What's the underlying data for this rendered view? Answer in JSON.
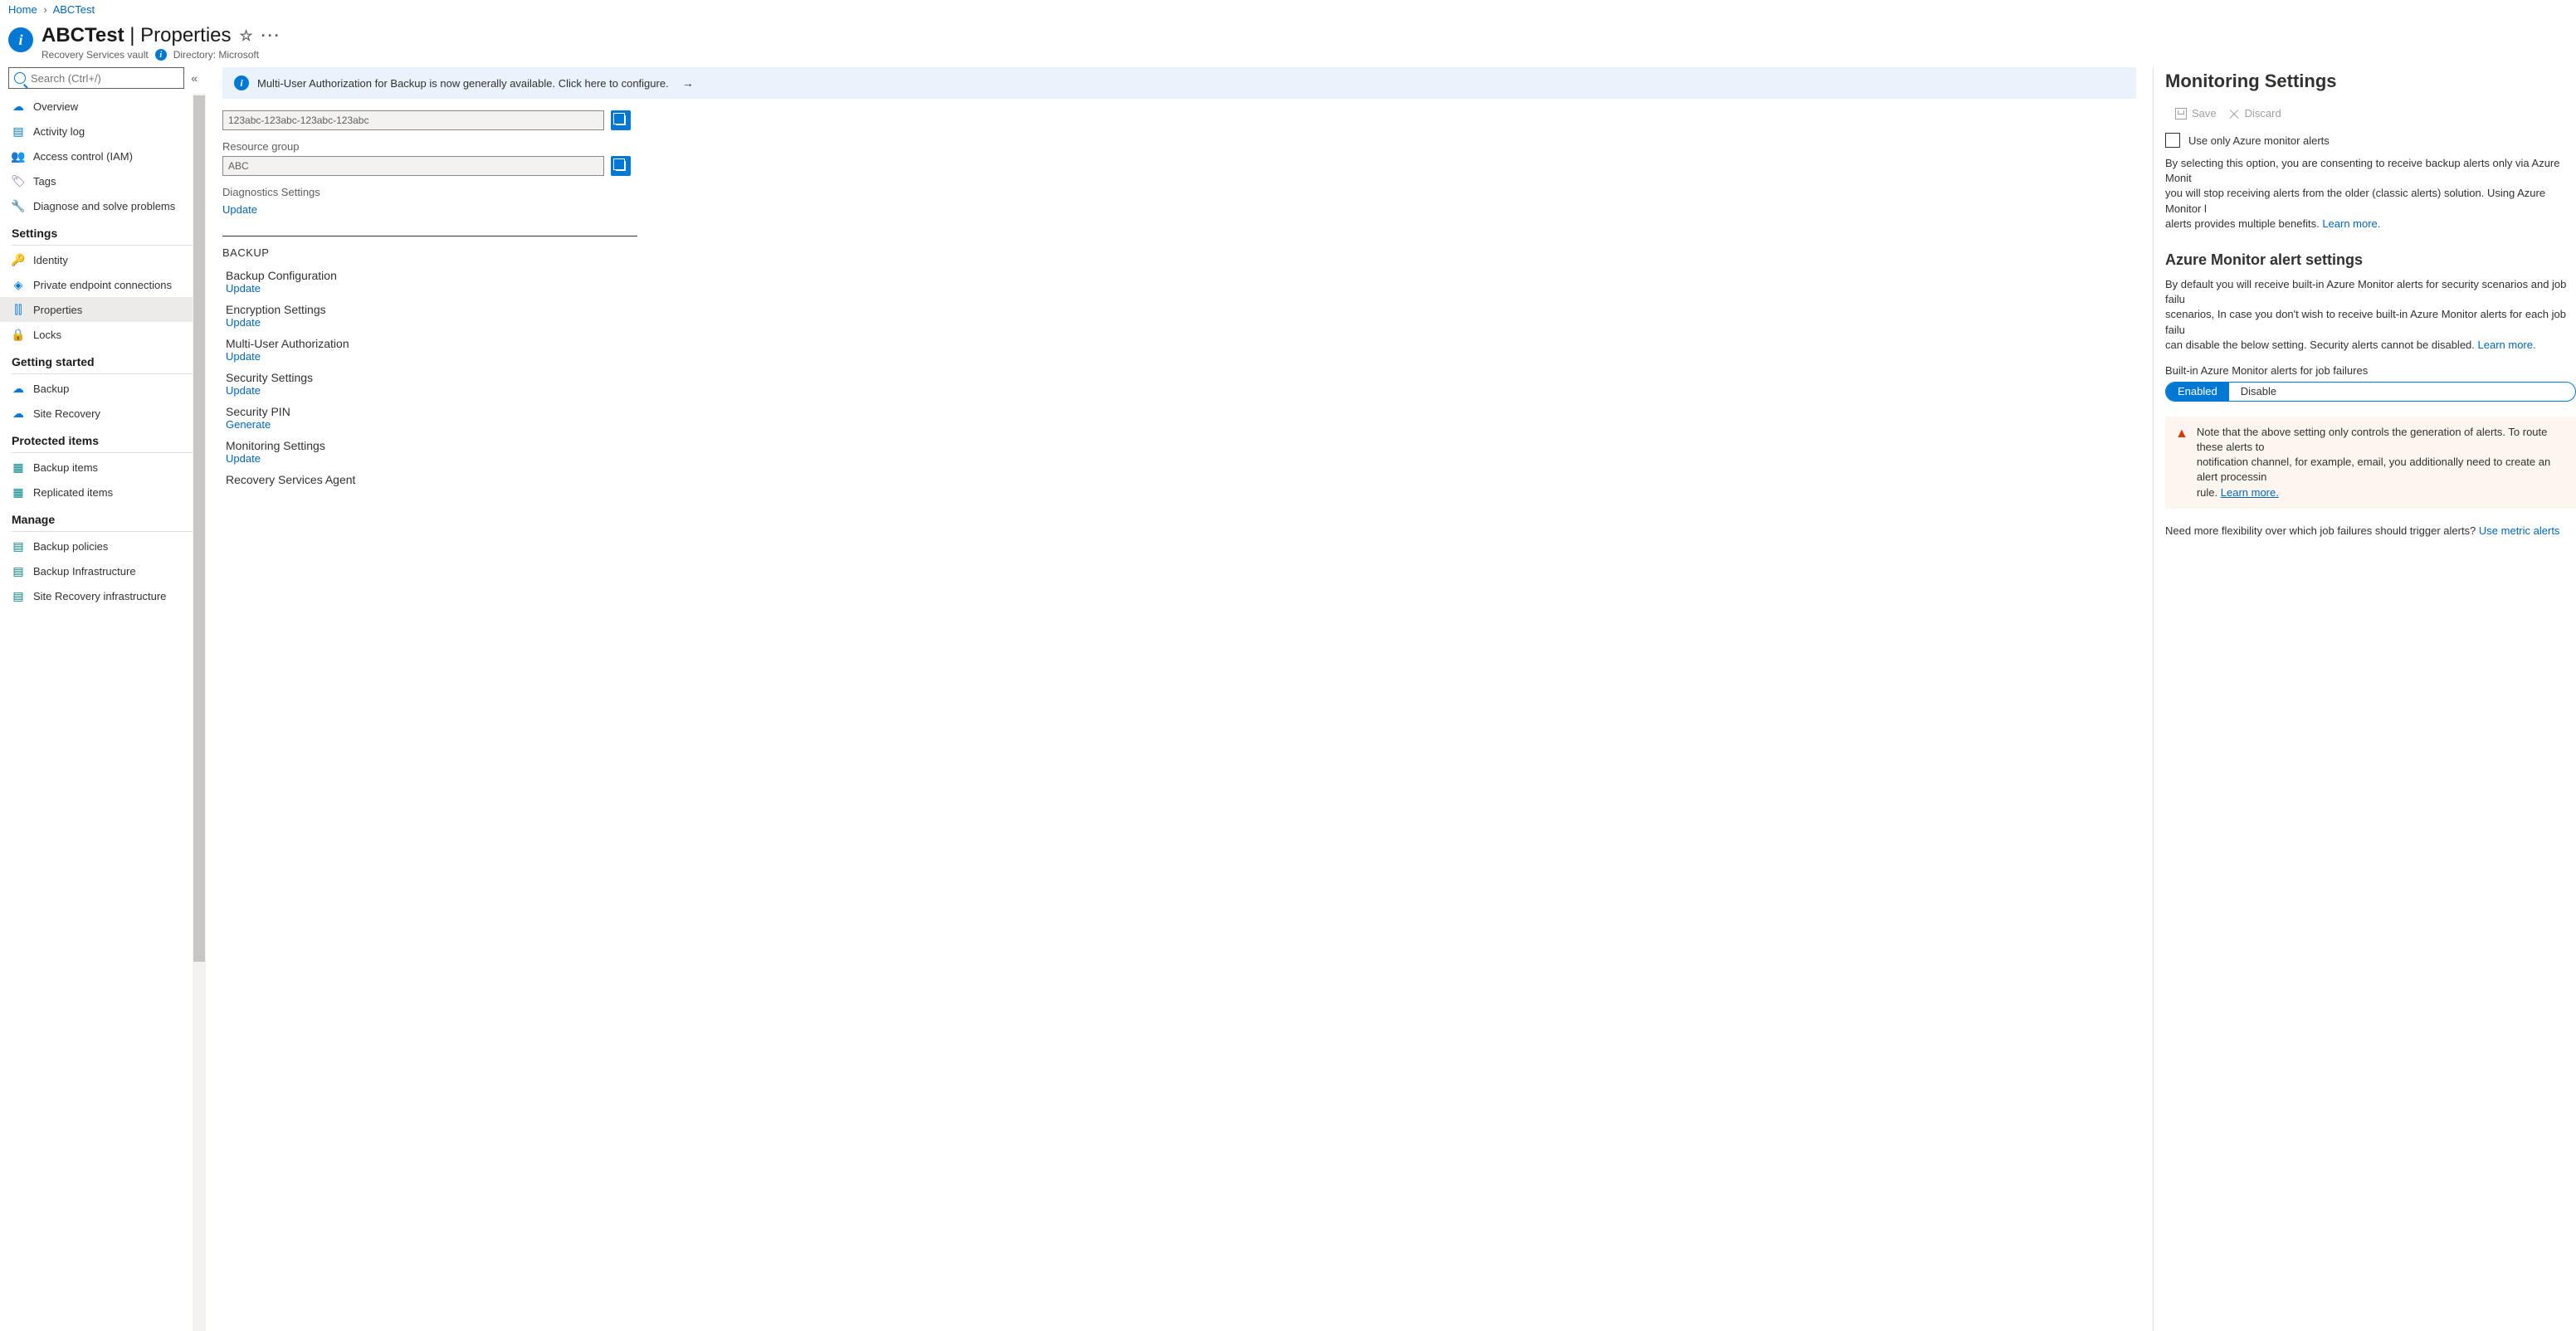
{
  "breadcrumb": {
    "home": "Home",
    "current": "ABCTest"
  },
  "header": {
    "title_name": "ABCTest",
    "title_sep": " | ",
    "title_page": "Properties",
    "subtitle_left": "Recovery Services vault",
    "subtitle_right": "Directory: Microsoft"
  },
  "search": {
    "placeholder": "Search (Ctrl+/)"
  },
  "nav": {
    "items_top": [
      {
        "label": "Overview"
      },
      {
        "label": "Activity log"
      },
      {
        "label": "Access control (IAM)"
      },
      {
        "label": "Tags"
      },
      {
        "label": "Diagnose and solve problems"
      }
    ],
    "settings_header": "Settings",
    "settings": [
      {
        "label": "Identity"
      },
      {
        "label": "Private endpoint connections"
      },
      {
        "label": "Properties"
      },
      {
        "label": "Locks"
      }
    ],
    "getting_started_header": "Getting started",
    "getting_started": [
      {
        "label": "Backup"
      },
      {
        "label": "Site Recovery"
      }
    ],
    "protected_header": "Protected items",
    "protected": [
      {
        "label": "Backup items"
      },
      {
        "label": "Replicated items"
      }
    ],
    "manage_header": "Manage",
    "manage": [
      {
        "label": "Backup policies"
      },
      {
        "label": "Backup Infrastructure"
      },
      {
        "label": "Site Recovery infrastructure"
      }
    ]
  },
  "banner": {
    "text": "Multi-User Authorization for Backup is now generally available. Click here to configure."
  },
  "fields": {
    "id_value": "123abc-123abc-123abc-123abc",
    "rg_label": "Resource group",
    "rg_value": "ABC",
    "diag_label": "Diagnostics Settings",
    "diag_action": "Update"
  },
  "backup": {
    "section": "BACKUP",
    "items": [
      {
        "label": "Backup Configuration",
        "action": "Update"
      },
      {
        "label": "Encryption Settings",
        "action": "Update"
      },
      {
        "label": "Multi-User Authorization",
        "action": "Update"
      },
      {
        "label": "Security Settings",
        "action": "Update"
      },
      {
        "label": "Security PIN",
        "action": "Generate"
      },
      {
        "label": "Monitoring Settings",
        "action": "Update"
      },
      {
        "label": "Recovery Services Agent",
        "action": ""
      }
    ]
  },
  "panel": {
    "title": "Monitoring Settings",
    "save": "Save",
    "discard": "Discard",
    "checkbox_label": "Use only Azure monitor alerts",
    "para1_a": "By selecting this option, you are consenting to receive backup alerts only via Azure Monit",
    "para1_b": "you will stop receiving alerts from the older (classic alerts) solution. Using Azure Monitor l",
    "para1_c": "alerts provides multiple benefits. ",
    "learn_more": "Learn more.",
    "h3": "Azure Monitor alert settings",
    "para2_a": "By default you will receive built-in Azure Monitor alerts for security scenarios and job failu",
    "para2_b": "scenarios, In case you don't wish to receive built-in Azure Monitor alerts for each job failu",
    "para2_c": "can disable the below setting. Security alerts cannot be disabled. ",
    "toggle_label": "Built-in Azure Monitor alerts for job failures",
    "enabled": "Enabled",
    "disable": "Disable",
    "warn_a": "Note that the above setting only controls the generation of alerts. To route these alerts to",
    "warn_b": "notification channel, for example, email, you additionally need to create an alert processin",
    "warn_c": "rule. ",
    "flex_text": "Need more flexibility over which job failures should trigger alerts? ",
    "metric_link": "Use metric alerts"
  }
}
